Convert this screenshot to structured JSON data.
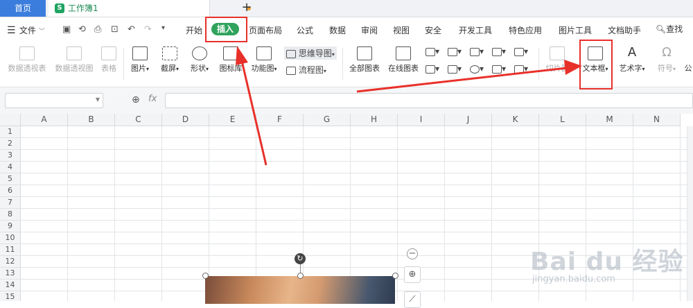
{
  "tabs": {
    "home": "首页",
    "doc_icon": "S",
    "doc_name": "工作簿1",
    "add": "+"
  },
  "menu": {
    "file": "文件",
    "items": [
      "开始",
      "页面布局",
      "公式",
      "数据",
      "审阅",
      "视图",
      "安全",
      "开发工具",
      "特色应用",
      "图片工具",
      "文档助手"
    ],
    "active": "插入",
    "search": "查找"
  },
  "ribbon": {
    "pivot_table": "数据透视表",
    "pivot_chart": "数据透视图",
    "table": "表格",
    "picture": "图片",
    "screenshot": "截屏",
    "shape": "形状",
    "icon_lib": "图标库",
    "func_chart": "功能图",
    "mindmap": "思维导图",
    "flowchart": "流程图",
    "all_charts": "全部图表",
    "online_chart": "在线图表",
    "slicer": "切片器",
    "textbox": "文本框",
    "wordart": "艺术字",
    "symbol": "符号",
    "formula": "公"
  },
  "formula_bar": {
    "fx": "fx"
  },
  "columns": [
    "A",
    "B",
    "C",
    "D",
    "E",
    "F",
    "G",
    "H",
    "I",
    "J",
    "K",
    "L",
    "M",
    "N"
  ],
  "rows": [
    "1",
    "2",
    "3",
    "4",
    "5",
    "6",
    "7",
    "8",
    "9",
    "10",
    "11",
    "12",
    "13",
    "14",
    "15"
  ],
  "watermark": {
    "main": "Bai du 经验",
    "sub": "jingyan.baidu.com"
  },
  "colors": {
    "accent_green": "#2fa35c",
    "tab_blue": "#3b7ddd",
    "annotation_red": "#e8302a"
  }
}
